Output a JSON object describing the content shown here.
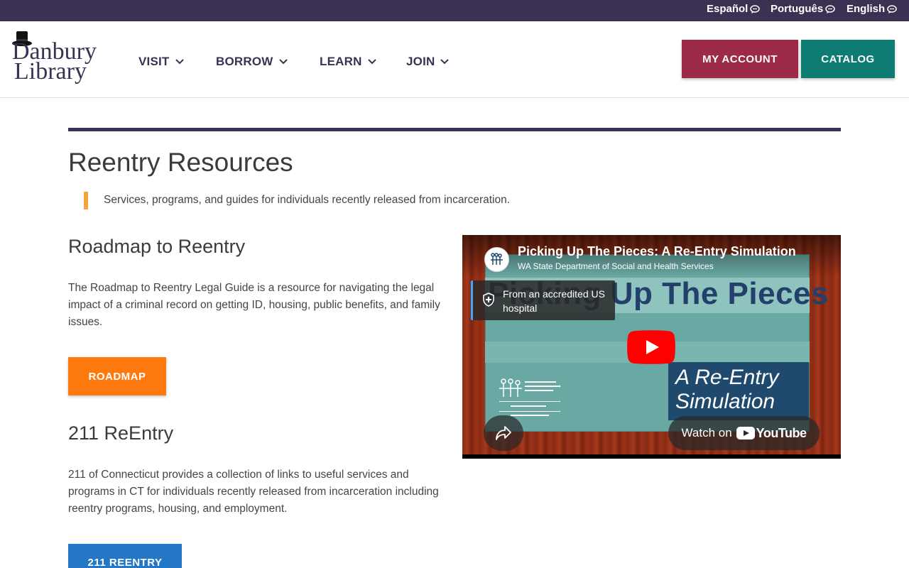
{
  "language_bar": {
    "languages": [
      {
        "label": "Español"
      },
      {
        "label": "Português"
      },
      {
        "label": "English"
      }
    ]
  },
  "header": {
    "logo_line1": "Danbury",
    "logo_line2": "Library",
    "nav": [
      {
        "label": "VISIT"
      },
      {
        "label": "BORROW"
      },
      {
        "label": "LEARN"
      },
      {
        "label": "JOIN"
      }
    ],
    "account_label": "MY ACCOUNT",
    "catalog_label": "CATALOG"
  },
  "page": {
    "title": "Reentry Resources",
    "subtitle": "Services, programs, and guides for individuals recently released from incarceration."
  },
  "sections": [
    {
      "title": "Roadmap to Reentry",
      "text": "The Roadmap to Reentry Legal Guide is a resource for navigating the legal impact of a criminal record on getting ID, housing, public benefits, and family issues.",
      "button": "ROADMAP"
    },
    {
      "title": "211 ReEntry",
      "text": "211 of Connecticut provides a collection of links to useful services and programs in CT for individuals recently released from incarceration including reentry programs, housing, and employment.",
      "button": "211 REENTRY"
    }
  ],
  "video": {
    "title": "Picking Up The Pieces: A Re-Entry Simulation",
    "channel": "WA State Department of Social and Health Services",
    "health_notice": "From an accredited US hospital",
    "thumbnail_title": "Picking Up The Pieces",
    "thumbnail_subtitle_line1": "A Re-Entry",
    "thumbnail_subtitle_line2": "Simulation",
    "watch_on_label": "Watch on",
    "youtube_label": "YouTube",
    "play_color": "#ff0000"
  },
  "colors": {
    "brand_purple": "#3b3152",
    "account_red": "#9d2a46",
    "catalog_teal": "#0e7c72",
    "roadmap_orange": "#ff7a0e",
    "reentry_blue": "#2477c7",
    "accent_orange": "#f4a340"
  }
}
